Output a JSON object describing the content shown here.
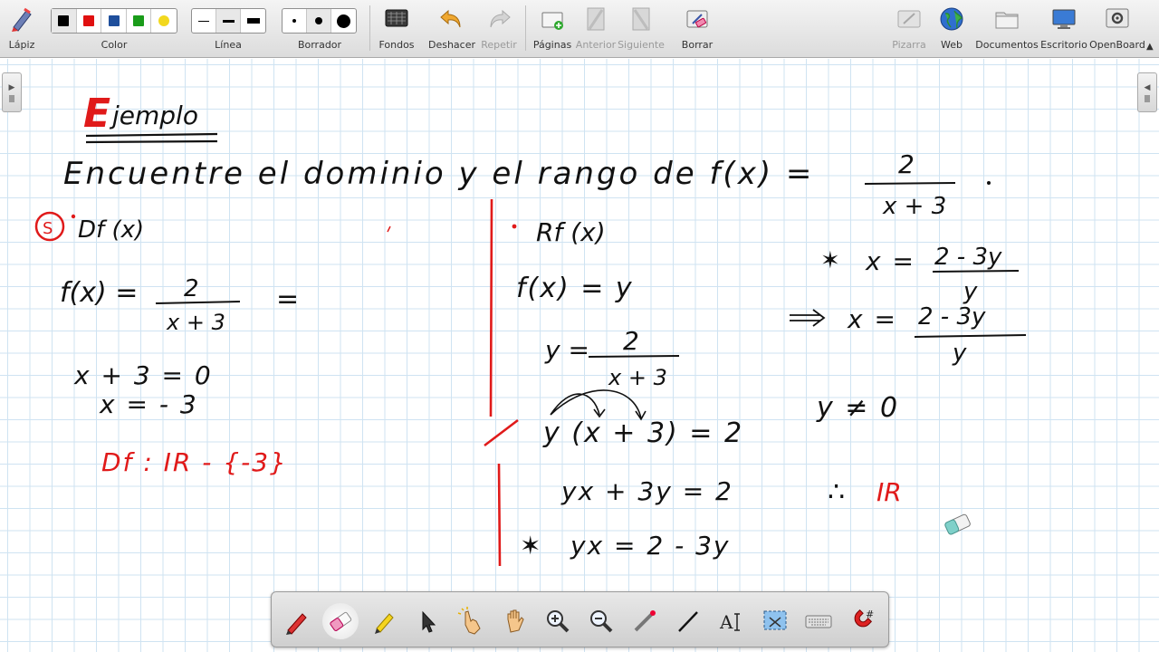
{
  "toolbar": {
    "tools": [
      {
        "id": "pencil",
        "label": "Lápiz",
        "icon": "pencil-icon",
        "disabled": false
      },
      {
        "id": "color",
        "label": "Color",
        "icon": "color-palette",
        "disabled": false
      },
      {
        "id": "line",
        "label": "Línea",
        "icon": "line-width",
        "disabled": false
      },
      {
        "id": "eraser",
        "label": "Borrador",
        "icon": "eraser-size",
        "disabled": false
      },
      {
        "id": "backgrounds",
        "label": "Fondos",
        "icon": "background-icon",
        "disabled": false
      },
      {
        "id": "undo",
        "label": "Deshacer",
        "icon": "undo-icon",
        "disabled": false
      },
      {
        "id": "redo",
        "label": "Repetir",
        "icon": "redo-icon",
        "disabled": true
      },
      {
        "id": "pages",
        "label": "Páginas",
        "icon": "add-page-icon",
        "disabled": false
      },
      {
        "id": "previous",
        "label": "Anterior",
        "icon": "previous-page-icon",
        "disabled": true
      },
      {
        "id": "next",
        "label": "Siguiente",
        "icon": "next-page-icon",
        "disabled": true
      },
      {
        "id": "erase",
        "label": "Borrar",
        "icon": "clear-page-icon",
        "disabled": false
      },
      {
        "id": "board",
        "label": "Pizarra",
        "icon": "board-icon",
        "disabled": true
      },
      {
        "id": "web",
        "label": "Web",
        "icon": "globe-icon",
        "disabled": false
      },
      {
        "id": "documents",
        "label": "Documentos",
        "icon": "folder-icon",
        "disabled": false
      },
      {
        "id": "desktop",
        "label": "Escritorio",
        "icon": "desktop-icon",
        "disabled": false
      },
      {
        "id": "openboard",
        "label": "OpenBoard",
        "icon": "gear-icon",
        "disabled": false
      }
    ],
    "colors": [
      "#000000",
      "#e01010",
      "#1f4f9c",
      "#1a9c1a",
      "#f2d81e"
    ],
    "accent_color": "#d72222"
  },
  "board": {
    "title_first_letter": "E",
    "title_rest": "jemplo",
    "prompt": "Encuentre el dominio y el rango de f(x) =",
    "fraction_num": "2",
    "fraction_den": "x + 3",
    "domain": {
      "bullet": "S",
      "heading": "Df (x)",
      "f_lhs": "f(x) =",
      "f_num": "2",
      "f_den": "x + 3",
      "eq_tail": "=",
      "step1": "x + 3 = 0",
      "step2": "x = - 3",
      "result": "Df :  IR - {-3}"
    },
    "range": {
      "heading": "Rf (x)",
      "s1": "f(x) = y",
      "s2_lhs": "y =",
      "s2_num": "2",
      "s2_den": "x + 3",
      "s3": "y (x + 3)  =  2",
      "s4": "yx + 3y = 2",
      "s5": "yx = 2 - 3y"
    },
    "right": {
      "r1_lhs": "x =",
      "r1_num": "2 - 3y",
      "r1_den": "y",
      "r2_lhs": "x =",
      "r2_num": "2 - 3y",
      "r2_den": "y",
      "r3": "y ≠ 0",
      "r4_sym": "∴",
      "r4_val": "IR"
    }
  },
  "bottom_toolbar": {
    "tools": [
      {
        "id": "pen",
        "icon": "pen-icon"
      },
      {
        "id": "eraser",
        "icon": "eraser-icon"
      },
      {
        "id": "highlighter",
        "icon": "highlighter-icon"
      },
      {
        "id": "select",
        "icon": "pointer-arrow-icon"
      },
      {
        "id": "interact",
        "icon": "pointing-hand-icon"
      },
      {
        "id": "hand",
        "icon": "hand-icon"
      },
      {
        "id": "zoom-in",
        "icon": "zoom-in-icon"
      },
      {
        "id": "zoom-out",
        "icon": "zoom-out-icon"
      },
      {
        "id": "laser",
        "icon": "laser-pointer-icon"
      },
      {
        "id": "line",
        "icon": "line-tool-icon"
      },
      {
        "id": "text",
        "icon": "text-tool-icon"
      },
      {
        "id": "capture",
        "icon": "capture-icon"
      },
      {
        "id": "keyboard",
        "icon": "keyboard-icon"
      },
      {
        "id": "magnet",
        "icon": "magnet-grid-icon"
      }
    ]
  }
}
